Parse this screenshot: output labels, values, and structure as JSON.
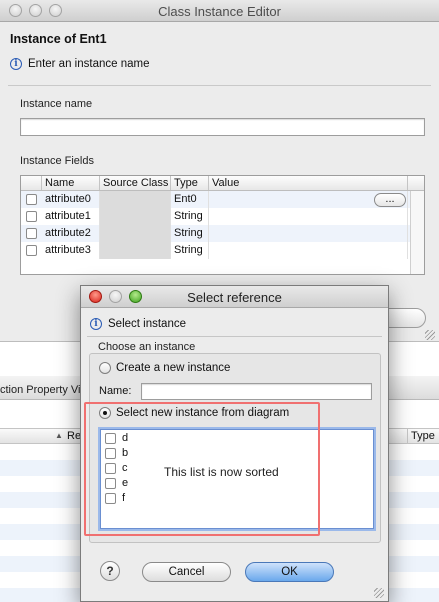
{
  "editor": {
    "title": "Class Instance Editor",
    "heading": "Instance of Ent1",
    "info": "Enter an instance name",
    "name_label": "Instance name",
    "name_value": "",
    "fields_label": "Instance Fields",
    "columns": [
      "Name",
      "Source Class",
      "Type",
      "Value"
    ],
    "rows": [
      {
        "name": "attribute0",
        "source": "",
        "type": "Ent0",
        "value": ""
      },
      {
        "name": "attribute1",
        "source": "",
        "type": "String",
        "value": ""
      },
      {
        "name": "attribute2",
        "source": "",
        "type": "String",
        "value": ""
      },
      {
        "name": "attribute3",
        "source": "",
        "type": "String",
        "value": ""
      }
    ],
    "ellipsis_label": "..."
  },
  "background": {
    "tab_label": "ction Property Vi",
    "col_re": "Re",
    "col_type": "Type"
  },
  "dialog": {
    "title": "Select reference",
    "info": "Select instance",
    "choose_label": "Choose an instance",
    "option_new": "Create a new instance",
    "name_label": "Name:",
    "name_value": "",
    "option_diagram": "Select new instance from diagram",
    "list_items": [
      "d",
      "b",
      "c",
      "e",
      "f"
    ],
    "list_note": "This list is now sorted",
    "cancel": "Cancel",
    "ok": "OK",
    "help": "?"
  },
  "colors": {
    "highlight": "#f07070",
    "accent": "#6aa8ec"
  }
}
